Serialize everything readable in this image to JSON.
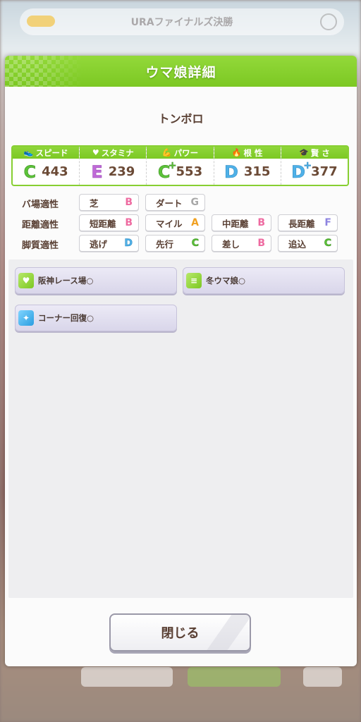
{
  "background": {
    "top_title": "URAファイナルズ決勝"
  },
  "dialog": {
    "title": "ウマ娘詳細",
    "character_name": "トンボロ"
  },
  "stats": [
    {
      "label": "スピード",
      "icon": "shoe-icon",
      "grade": "C",
      "plus": "",
      "value": "443"
    },
    {
      "label": "スタミナ",
      "icon": "heart-icon",
      "grade": "E",
      "plus": "",
      "value": "239"
    },
    {
      "label": "パワー",
      "icon": "muscle-icon",
      "grade": "C",
      "plus": "+",
      "value": "553"
    },
    {
      "label": "根 性",
      "icon": "flame-icon",
      "grade": "D",
      "plus": "",
      "value": "315"
    },
    {
      "label": "賢 さ",
      "icon": "graduation-cap-icon",
      "grade": "D",
      "plus": "+",
      "value": "377"
    }
  ],
  "aptitudes": {
    "track": {
      "label": "バ場適性",
      "items": [
        {
          "name": "芝",
          "grade": "B"
        },
        {
          "name": "ダート",
          "grade": "G"
        }
      ]
    },
    "distance": {
      "label": "距離適性",
      "items": [
        {
          "name": "短距離",
          "grade": "B"
        },
        {
          "name": "マイル",
          "grade": "A"
        },
        {
          "name": "中距離",
          "grade": "B"
        },
        {
          "name": "長距離",
          "grade": "F"
        }
      ]
    },
    "style": {
      "label": "脚質適性",
      "items": [
        {
          "name": "逃げ",
          "grade": "D"
        },
        {
          "name": "先行",
          "grade": "C"
        },
        {
          "name": "差し",
          "grade": "B"
        },
        {
          "name": "追込",
          "grade": "C"
        }
      ]
    }
  },
  "skills": [
    {
      "name": "阪神レース場○",
      "icon": "heart-skill-icon",
      "icon_color": "#8ccf3a"
    },
    {
      "name": "冬ウマ娘○",
      "icon": "notebook-skill-icon",
      "icon_color": "#8ccf3a"
    },
    {
      "name": "コーナー回復○",
      "icon": "sparkle-skill-icon",
      "icon_color": "#3aaee8"
    }
  ],
  "buttons": {
    "close_label": "閉じる"
  }
}
